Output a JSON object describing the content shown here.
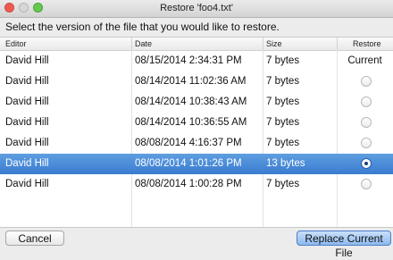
{
  "window": {
    "title": "Restore 'foo4.txt'"
  },
  "prompt": "Select the version of the file that you would like to restore.",
  "table": {
    "headers": {
      "editor": "Editor",
      "date": "Date",
      "size": "Size",
      "restore": "Restore"
    },
    "rows": [
      {
        "editor": "David Hill",
        "date": "08/15/2014 2:34:31 PM",
        "size": "7 bytes",
        "restore": "Current"
      },
      {
        "editor": "David Hill",
        "date": "08/14/2014 11:02:36 AM",
        "size": "7 bytes",
        "restore": ""
      },
      {
        "editor": "David Hill",
        "date": "08/14/2014 10:38:43 AM",
        "size": "7 bytes",
        "restore": ""
      },
      {
        "editor": "David Hill",
        "date": "08/14/2014 10:36:55 AM",
        "size": "7 bytes",
        "restore": ""
      },
      {
        "editor": "David Hill",
        "date": "08/08/2014 4:16:37 PM",
        "size": "7 bytes",
        "restore": ""
      },
      {
        "editor": "David Hill",
        "date": "08/08/2014 1:01:26 PM",
        "size": "13 bytes",
        "restore": ""
      },
      {
        "editor": "David Hill",
        "date": "08/08/2014 1:00:28 PM",
        "size": "7 bytes",
        "restore": ""
      }
    ],
    "selected_row": 5
  },
  "buttons": {
    "cancel": "Cancel",
    "replace": "Replace Current File"
  },
  "colors": {
    "selection": "#3a7bd0",
    "close": "#ec5b52",
    "maximize": "#63c94d"
  }
}
